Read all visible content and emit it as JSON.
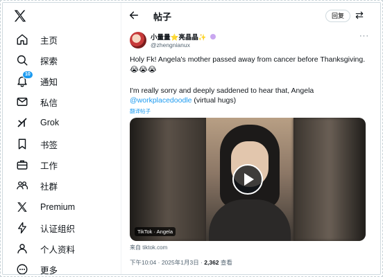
{
  "sidebar": {
    "items": [
      {
        "label": "主页",
        "icon": "home-icon"
      },
      {
        "label": "探索",
        "icon": "search-icon"
      },
      {
        "label": "通知",
        "icon": "bell-icon",
        "badge": "10"
      },
      {
        "label": "私信",
        "icon": "mail-icon"
      },
      {
        "label": "Grok",
        "icon": "grok-icon"
      },
      {
        "label": "书签",
        "icon": "bookmark-icon"
      },
      {
        "label": "工作",
        "icon": "briefcase-icon"
      },
      {
        "label": "社群",
        "icon": "people-icon"
      },
      {
        "label": "Premium",
        "icon": "x-icon"
      },
      {
        "label": "认证组织",
        "icon": "lightning-icon"
      },
      {
        "label": "个人资料",
        "icon": "person-icon"
      },
      {
        "label": "更多",
        "icon": "more-circle-icon"
      }
    ]
  },
  "header": {
    "title": "帖子",
    "reply_label": "回复"
  },
  "post": {
    "author_name": "小量量⭐亮晶晶✨",
    "handle": "@zhengnianux",
    "text1": "Holy Fk! Angela's mother passed away from cancer before Thanksgiving.",
    "emojis": "😭😭😭",
    "text2_prefix": "I'm really sorry and deeply saddened to hear that, Angela",
    "mention": "@workplacedoodle",
    "text2_suffix": " (virtual hugs)",
    "translate_label": "翻译帖子",
    "media_tag": "TikTok · Angela",
    "source": "来自 tiktok.com",
    "time": "下午10:04 · 2025年1月3日 · ",
    "views_count": "2,362",
    "views_label": " 查看"
  },
  "colors": {
    "accent": "#1d9bf0",
    "text": "#0f1419",
    "muted": "#536471"
  }
}
